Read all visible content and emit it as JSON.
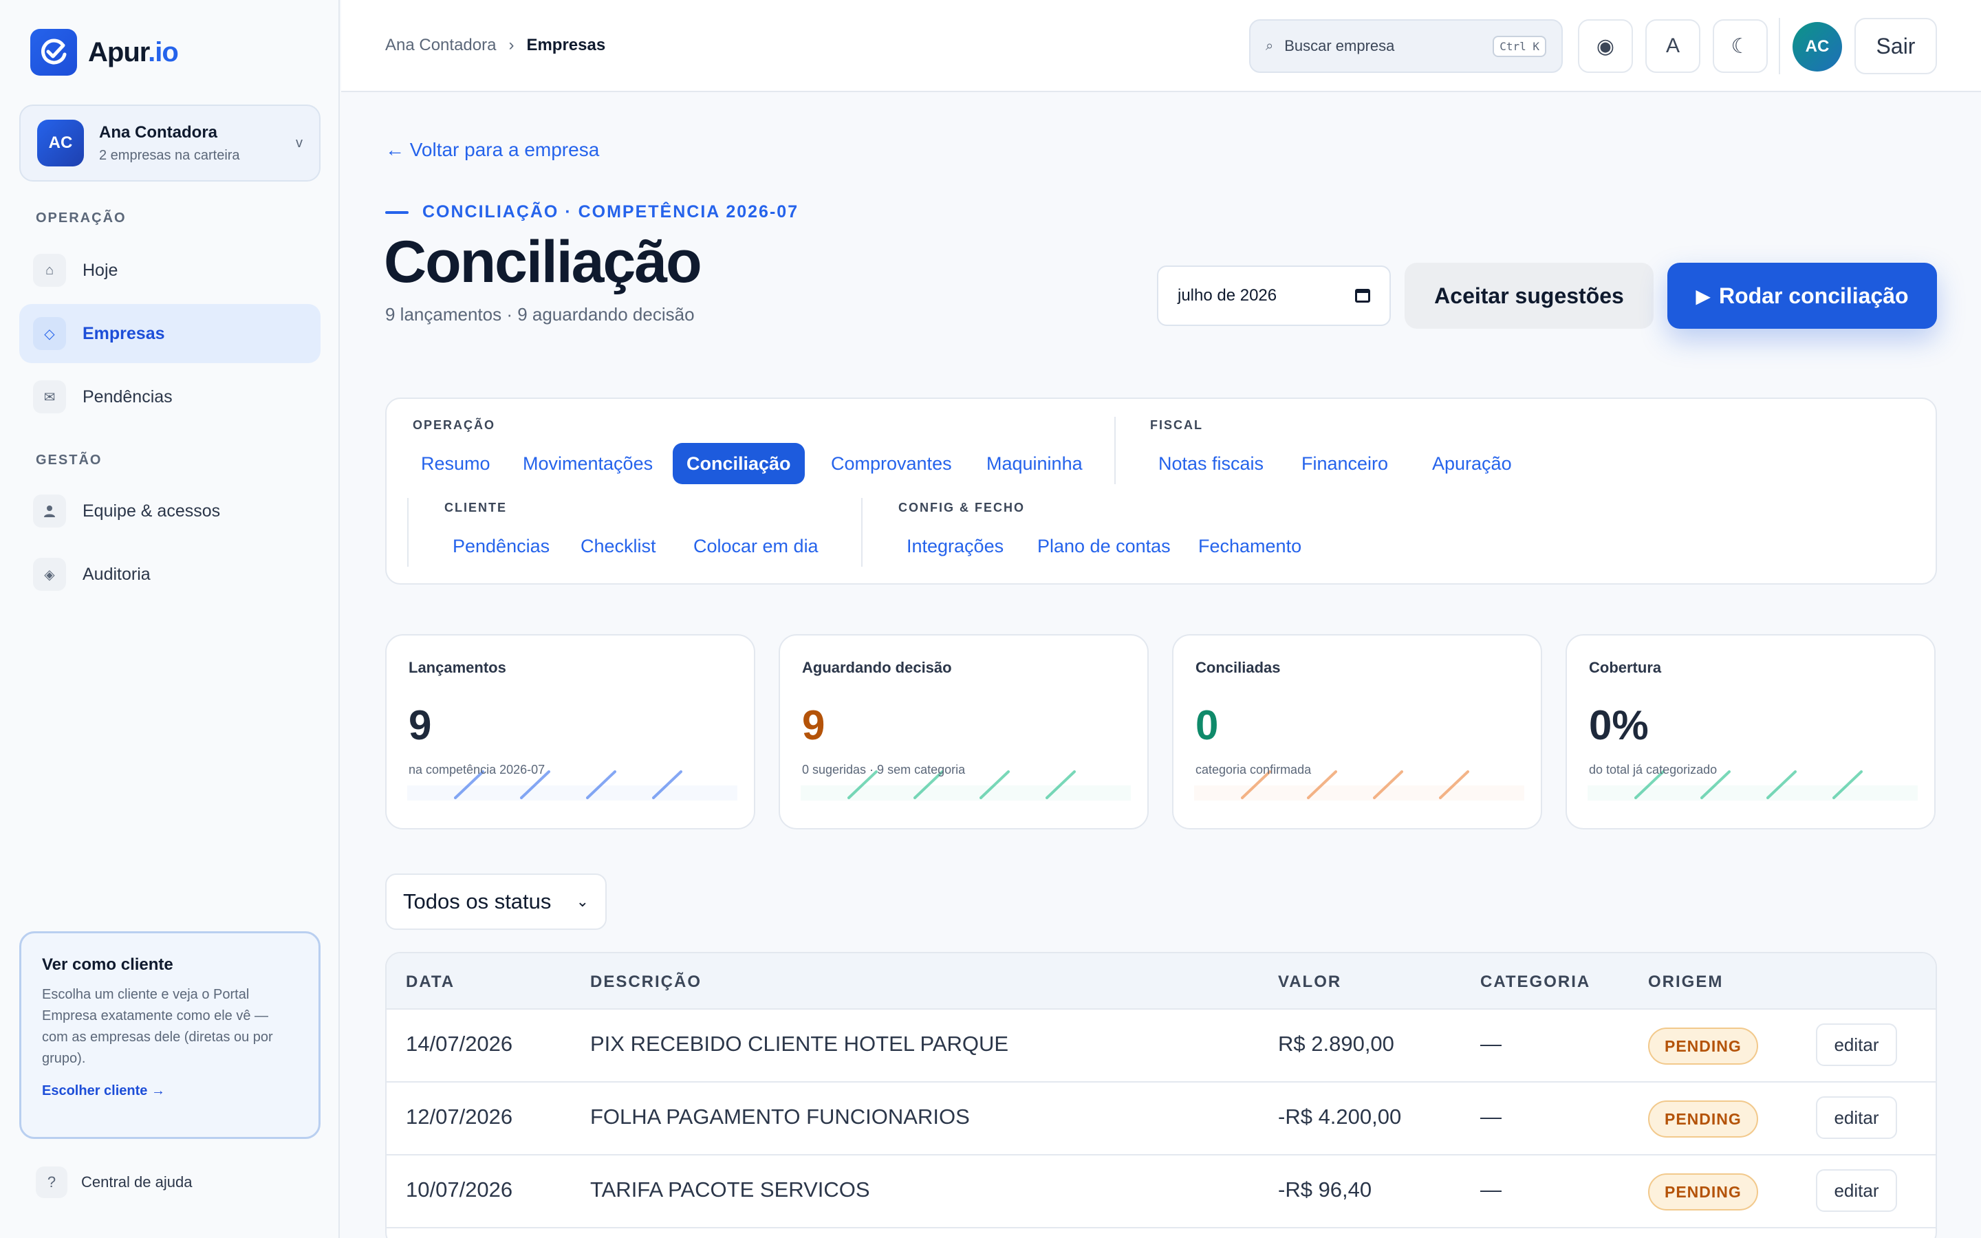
{
  "brand": {
    "name_main": "Apur",
    "name_accent": ".io"
  },
  "account": {
    "initials": "AC",
    "name": "Ana Contadora",
    "subtitle": "2 empresas na carteira",
    "chevron": "v"
  },
  "sidebar": {
    "section_operacao": "OPERAÇÃO",
    "section_gestao": "GESTÃO",
    "items": [
      {
        "label": "Hoje",
        "icon": "home-icon",
        "glyph": "⌂"
      },
      {
        "label": "Empresas",
        "icon": "diamond-icon",
        "glyph": "◇"
      },
      {
        "label": "Pendências",
        "icon": "mail-icon",
        "glyph": "✉"
      },
      {
        "label": "Equipe & acessos",
        "icon": "user-icon",
        "glyph": "👤"
      },
      {
        "label": "Auditoria",
        "icon": "audit-icon",
        "glyph": "◈"
      }
    ],
    "active": "Empresas",
    "client_card": {
      "title": "Ver como cliente",
      "description": "Escolha um cliente e veja o Portal Empresa exatamente como ele vê — com as empresas dele (diretas ou por grupo).",
      "link": "Escolher cliente →"
    },
    "help": {
      "glyph": "?",
      "label": "Central de ajuda"
    }
  },
  "topbar": {
    "breadcrumb": {
      "root": "Ana Contadora",
      "sep": "›",
      "current": "Empresas"
    },
    "search": {
      "placeholder": "Buscar empresa",
      "shortcut": "Ctrl K",
      "glyph": "⌕"
    },
    "buttons": {
      "focus_glyph": "◉",
      "font_glyph": "A",
      "theme_glyph": "☾"
    },
    "user_initials": "AC",
    "logout": "Sair"
  },
  "page": {
    "back": "← Voltar para a empresa",
    "eyebrow": "CONCILIAÇÃO · COMPETÊNCIA 2026-07",
    "title": "Conciliação",
    "subtitle": "9 lançamentos · 9 aguardando decisão",
    "month": "julho de 2026",
    "accept_button": "Aceitar sugestões",
    "run_button": "Rodar conciliação",
    "run_glyph": "▶"
  },
  "tabs": {
    "operacao_label": "OPERAÇÃO",
    "operacao": [
      "Resumo",
      "Movimentações",
      "Conciliação",
      "Comprovantes",
      "Maquininha"
    ],
    "fiscal_label": "FISCAL",
    "fiscal": [
      "Notas fiscais",
      "Financeiro",
      "Apuração"
    ],
    "cliente_label": "CLIENTE",
    "cliente": [
      "Pendências",
      "Checklist",
      "Colocar em dia"
    ],
    "config_label": "CONFIG & FECHO",
    "config": [
      "Integrações",
      "Plano de contas",
      "Fechamento"
    ],
    "active": "Conciliação"
  },
  "kpis": [
    {
      "label": "Lançamentos",
      "value": "9",
      "foot": "na competência 2026-07",
      "color": "#1e293b",
      "deco": "#2563eb"
    },
    {
      "label": "Aguardando decisão",
      "value": "9",
      "foot": "0 sugeridas · 9 sem categoria",
      "color": "#b45309",
      "deco": "#10b981"
    },
    {
      "label": "Conciliadas",
      "value": "0",
      "foot": "categoria confirmada",
      "color": "#0f8a6a",
      "deco": "#ea7a2c"
    },
    {
      "label": "Cobertura",
      "value": "0%",
      "foot": "do total já categorizado",
      "color": "#1e293b",
      "deco": "#10b981"
    }
  ],
  "filter": {
    "status": "Todos os status",
    "chevron": "⌄"
  },
  "table": {
    "headers": {
      "date": "DATA",
      "description": "DESCRIÇÃO",
      "value": "VALOR",
      "category": "CATEGORIA",
      "origin": "ORIGEM"
    },
    "rows": [
      {
        "date": "14/07/2026",
        "description": "PIX RECEBIDO CLIENTE HOTEL PARQUE",
        "value": "R$ 2.890,00",
        "category": "—",
        "status": "PENDING",
        "action": "editar"
      },
      {
        "date": "12/07/2026",
        "description": "FOLHA PAGAMENTO FUNCIONARIOS",
        "value": "-R$ 4.200,00",
        "category": "—",
        "status": "PENDING",
        "action": "editar"
      },
      {
        "date": "10/07/2026",
        "description": "TARIFA PACOTE SERVICOS",
        "value": "-R$ 96,40",
        "category": "—",
        "status": "PENDING",
        "action": "editar"
      }
    ]
  }
}
